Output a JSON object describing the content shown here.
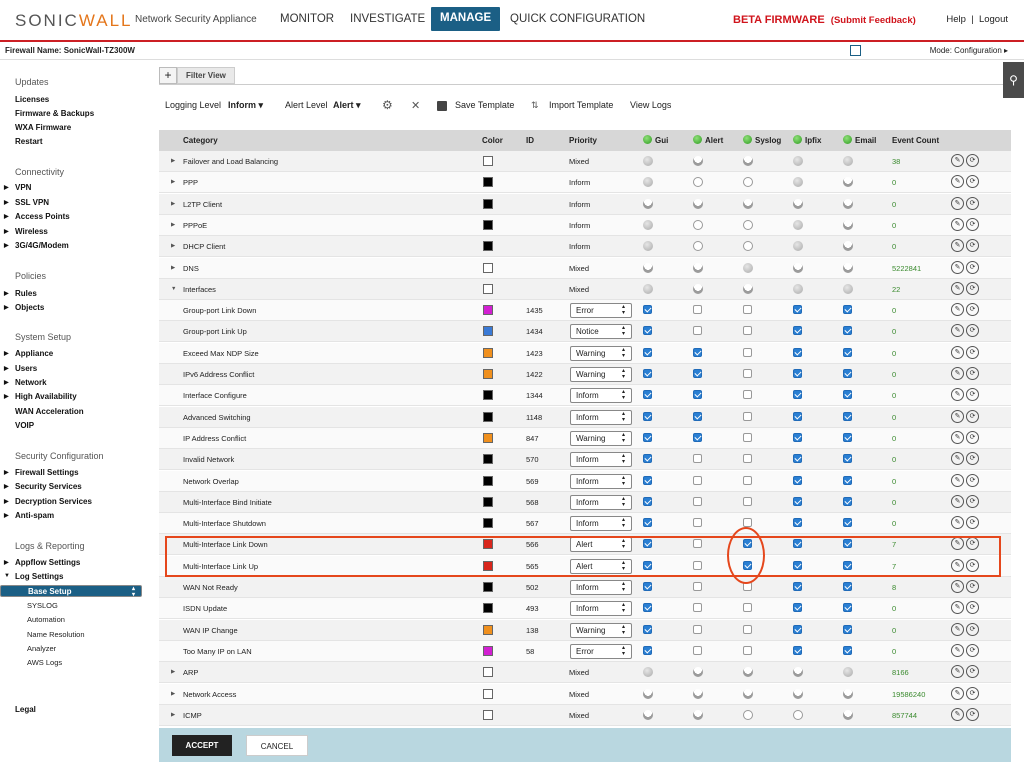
{
  "header": {
    "logo_a": "SONIC",
    "logo_b": "WALL",
    "product": "Network Security Appliance",
    "nav": [
      "MONITOR",
      "INVESTIGATE",
      "MANAGE",
      "QUICK CONFIGURATION"
    ],
    "beta": "BETA FIRMWARE",
    "beta_link": "(Submit Feedback)",
    "help": "Help",
    "sep": "|",
    "logout": "Logout"
  },
  "fwbar": {
    "name": "Firewall Name: SonicWall-TZ300W",
    "mode": "Mode:  Configuration ▸"
  },
  "sidebar": {
    "updates": "Updates",
    "licenses": "Licenses",
    "firmware": "Firmware & Backups",
    "wxa": "WXA Firmware",
    "restart": "Restart",
    "connectivity": "Connectivity",
    "vpn": "VPN",
    "sslvpn": "SSL VPN",
    "ap": "Access Points",
    "wireless": "Wireless",
    "modem": "3G/4G/Modem",
    "policies": "Policies",
    "rules": "Rules",
    "objects": "Objects",
    "system": "System Setup",
    "appliance": "Appliance",
    "users": "Users",
    "network": "Network",
    "ha": "High Availability",
    "wan": "WAN Acceleration",
    "voip": "VOIP",
    "security": "Security Configuration",
    "fw": "Firewall Settings",
    "ss": "Security Services",
    "ds": "Decryption Services",
    "as": "Anti-spam",
    "logs": "Logs & Reporting",
    "appflow": "Appflow Settings",
    "logset": "Log Settings",
    "base": "Base Setup",
    "syslog": "SYSLOG",
    "auto": "Automation",
    "nr": "Name Resolution",
    "analyzer": "Analyzer",
    "aws": "AWS Logs",
    "legal": "Legal"
  },
  "breadcrumb": {
    "plus": "+",
    "view": "Filter View"
  },
  "toolbar": {
    "log_level_label": "Logging Level",
    "log_level": "Inform ▾",
    "alert_level_label": "Alert Level",
    "alert_level": "Alert ▾",
    "gear": "⚙",
    "close": "✕",
    "save": "Save Template",
    "import": "Import Template",
    "view": "View Logs"
  },
  "table": {
    "headers": {
      "category": "Category",
      "color": "Color",
      "id": "ID",
      "priority": "Priority",
      "gui": "Gui",
      "alert": "Alert",
      "syslog": "Syslog",
      "ipfix": "Ipfix",
      "email": "Email",
      "count": "Event Count"
    },
    "rows": [
      {
        "name": "Failover and Load Balancing",
        "color": "#ffffff",
        "id": "",
        "prio": "Mixed",
        "count": "38"
      },
      {
        "name": "PPP",
        "color": "#000000",
        "id": "",
        "prio": "Inform",
        "count": "0"
      },
      {
        "name": "L2TP Client",
        "color": "#000000",
        "id": "",
        "prio": "Inform",
        "count": "0"
      },
      {
        "name": "PPPoE",
        "color": "#000000",
        "id": "",
        "prio": "Inform",
        "count": "0"
      },
      {
        "name": "DHCP Client",
        "color": "#000000",
        "id": "",
        "prio": "Inform",
        "count": "0"
      },
      {
        "name": "DNS",
        "color": "#ffffff",
        "id": "",
        "prio": "Mixed",
        "count": "5222841"
      },
      {
        "name": "Interfaces",
        "color": "#ffffff",
        "id": "",
        "prio": "Mixed",
        "count": "22"
      },
      {
        "name": "Group-port Link Down",
        "color": "#d21fd2",
        "id": "1435",
        "prio": "Error",
        "count": "0"
      },
      {
        "name": "Group-port Link Up",
        "color": "#3a7ad6",
        "id": "1434",
        "prio": "Notice",
        "count": "0"
      },
      {
        "name": "Exceed Max NDP Size",
        "color": "#f0901e",
        "id": "1423",
        "prio": "Warning",
        "count": "0"
      },
      {
        "name": "IPv6 Address Conflict",
        "color": "#f0901e",
        "id": "1422",
        "prio": "Warning",
        "count": "0"
      },
      {
        "name": "Interface Configure",
        "color": "#000000",
        "id": "1344",
        "prio": "Inform",
        "count": "0"
      },
      {
        "name": "Advanced Switching",
        "color": "#000000",
        "id": "1148",
        "prio": "Inform",
        "count": "0"
      },
      {
        "name": "IP Address Conflict",
        "color": "#f0901e",
        "id": "847",
        "prio": "Warning",
        "count": "0"
      },
      {
        "name": "Invalid Network",
        "color": "#000000",
        "id": "570",
        "prio": "Inform",
        "count": "0"
      },
      {
        "name": "Network Overlap",
        "color": "#000000",
        "id": "569",
        "prio": "Inform",
        "count": "0"
      },
      {
        "name": "Multi-Interface Bind Initiate",
        "color": "#000000",
        "id": "568",
        "prio": "Inform",
        "count": "0"
      },
      {
        "name": "Multi-Interface Shutdown",
        "color": "#000000",
        "id": "567",
        "prio": "Inform",
        "count": "0"
      },
      {
        "name": "Multi-Interface Link Down",
        "color": "#d8261c",
        "id": "566",
        "prio": "Alert",
        "count": "7"
      },
      {
        "name": "Multi-Interface Link Up",
        "color": "#d8261c",
        "id": "565",
        "prio": "Alert",
        "count": "7"
      },
      {
        "name": "WAN Not Ready",
        "color": "#000000",
        "id": "502",
        "prio": "Inform",
        "count": "8"
      },
      {
        "name": "ISDN Update",
        "color": "#000000",
        "id": "493",
        "prio": "Inform",
        "count": "0"
      },
      {
        "name": "WAN IP Change",
        "color": "#f0901e",
        "id": "138",
        "prio": "Warning",
        "count": "0"
      },
      {
        "name": "Too Many IP on LAN",
        "color": "#d21fd2",
        "id": "58",
        "prio": "Error",
        "count": "0"
      },
      {
        "name": "ARP",
        "color": "#ffffff",
        "id": "",
        "prio": "Mixed",
        "count": "8166"
      },
      {
        "name": "Network Access",
        "color": "#ffffff",
        "id": "",
        "prio": "Mixed",
        "count": "19586240"
      },
      {
        "name": "ICMP",
        "color": "#ffffff",
        "id": "",
        "prio": "Mixed",
        "count": "857744"
      }
    ]
  },
  "footer": {
    "accept": "ACCEPT",
    "cancel": "CANCEL"
  }
}
